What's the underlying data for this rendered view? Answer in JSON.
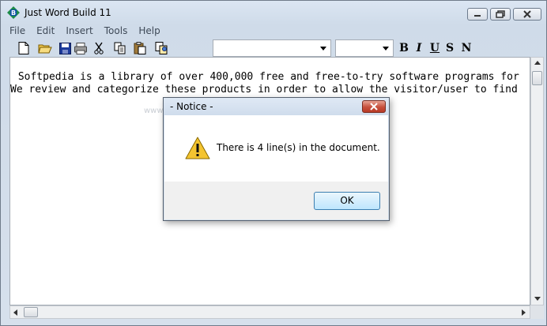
{
  "window": {
    "title": "Just Word Build 11",
    "app_icon_letter": "B"
  },
  "menu": {
    "items": [
      {
        "label": "File"
      },
      {
        "label": "Edit"
      },
      {
        "label": "Insert"
      },
      {
        "label": "Tools"
      },
      {
        "label": "Help"
      }
    ]
  },
  "toolbar": {
    "buttons": [
      "new-document-icon",
      "open-folder-icon",
      "save-disk-icon",
      "print-icon",
      "cut-scissors-icon",
      "copy-icon",
      "paste-icon",
      "find-replace-icon"
    ],
    "font_name_value": "",
    "font_size_value": "",
    "bold_label": "B",
    "italic_label": "I",
    "underline_label": "U",
    "strike_label": "S",
    "normal_label": "N"
  },
  "document": {
    "lines": [
      " Softpedia is a library of over 400,000 free and free-to-try software programs for",
      "We review and categorize these products in order to allow the visitor/user to find"
    ]
  },
  "dialog": {
    "title": "- Notice -",
    "message": "There is 4 line(s) in the document.",
    "ok_label": "OK",
    "icon": "warning-triangle-icon"
  },
  "watermark": "www.softpedia.com",
  "colors": {
    "window_frame": "#6f7b8a",
    "title_gradient": "#dbe6f3",
    "close_button_red": "#c7503c",
    "ok_button_border": "#3c7fb1"
  }
}
